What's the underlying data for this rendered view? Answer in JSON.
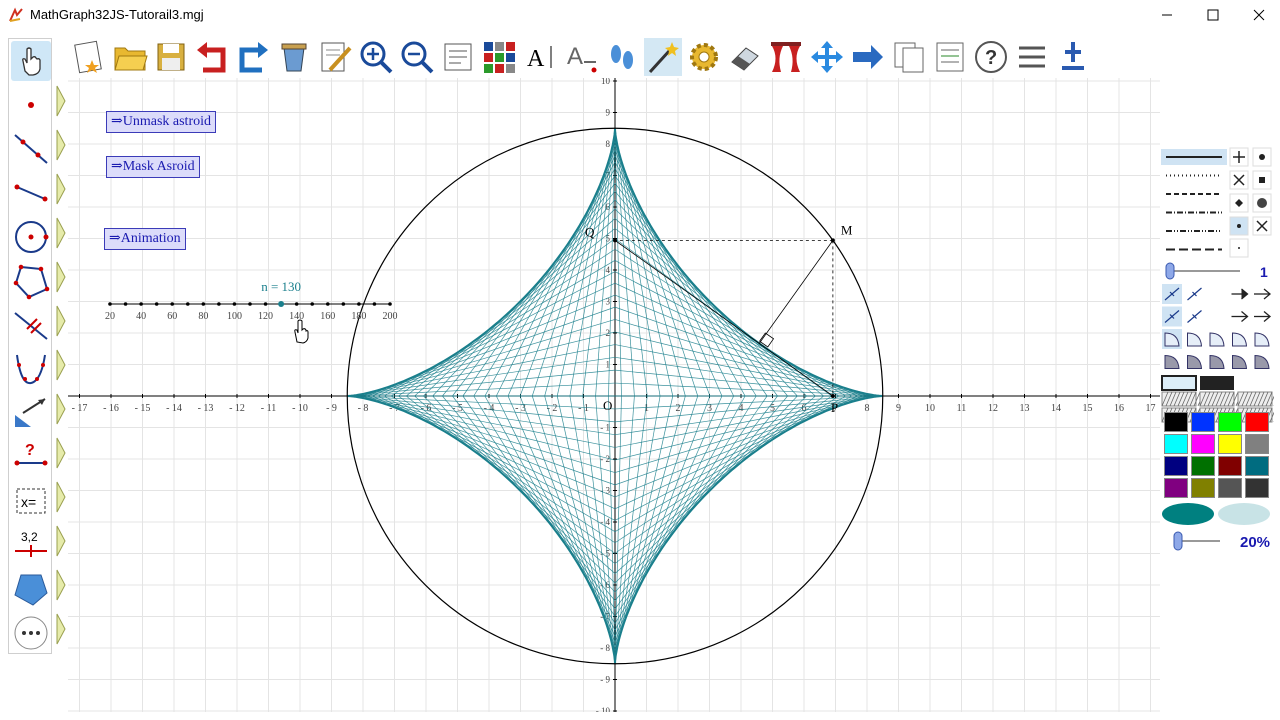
{
  "window": {
    "title": "MathGraph32JS-Tutorail3.mgj",
    "icons": [
      "app-icon",
      "minimize-icon",
      "maximize-icon",
      "close-icon"
    ]
  },
  "left_toolbar": {
    "tools": [
      {
        "name": "pointer-tool",
        "icon": "hand-pointer-icon"
      },
      {
        "name": "point-tool",
        "icon": "point-icon"
      },
      {
        "name": "line-tool",
        "icon": "line-icon"
      },
      {
        "name": "segment-tool",
        "icon": "segment-icon"
      },
      {
        "name": "circle-tool",
        "icon": "circle-icon"
      },
      {
        "name": "polygon-tool",
        "icon": "polygon-icon"
      },
      {
        "name": "parallel-perpendicular-tool",
        "icon": "parallel-icon"
      },
      {
        "name": "curve-tool",
        "icon": "curve-icon"
      },
      {
        "name": "transformation-tool",
        "icon": "transformation-icon"
      },
      {
        "name": "measure-tool",
        "icon": "measure-icon"
      },
      {
        "name": "calculation-tool",
        "icon": "calculation-icon"
      },
      {
        "name": "display-value-tool",
        "icon": "display-value-icon"
      },
      {
        "name": "surface-tool",
        "icon": "surface-icon"
      },
      {
        "name": "more-tools",
        "icon": "more-icon"
      }
    ],
    "calc_label": "x=",
    "value_label": "3,2"
  },
  "top_toolbar": {
    "tools": [
      "new-figure-icon",
      "open-icon",
      "save-icon",
      "undo-icon",
      "redo-icon",
      "recycle-bin-icon",
      "edit-icon",
      "zoom-in-icon",
      "zoom-out-icon",
      "protocol-icon",
      "palette-icon",
      "text-icon",
      "text-format-icon",
      "footprint-icon",
      "wand-icon",
      "settings-icon",
      "eraser-icon",
      "curtain-icon",
      "move-icon",
      "arrow-right-icon",
      "copy-icon",
      "list-icon",
      "help-icon",
      "menu-icon",
      "pin-icon"
    ],
    "text_tool_label": "A"
  },
  "canvas": {
    "macros": [
      {
        "label": "⇒Unmask astroid"
      },
      {
        "label": "⇒Mask Asroid"
      },
      {
        "label": "⇒Animation"
      }
    ],
    "slider": {
      "label": "n = 130",
      "value": 130,
      "min": 20,
      "max": 200,
      "ticks": [
        "20",
        "40",
        "60",
        "80",
        "100",
        "120",
        "140",
        "160",
        "180",
        "200"
      ]
    },
    "x_axis": {
      "ticks": [
        "- 17",
        "- 16",
        "- 15",
        "- 14",
        "- 13",
        "- 12",
        "- 11",
        "- 10",
        "- 9",
        "- 8",
        "- 7",
        "- 6",
        "- 5",
        "- 4",
        "- 3",
        "- 2",
        "- 1",
        "0",
        "1",
        "2",
        "3",
        "4",
        "5",
        "6",
        "7",
        "8",
        "9",
        "10",
        "11",
        "12",
        "13",
        "14",
        "15",
        "16",
        "17"
      ]
    },
    "y_axis": {
      "ticks": [
        "- 10",
        "- 9",
        "- 8",
        "- 7",
        "- 6",
        "- 5",
        "- 4",
        "- 3",
        "- 2",
        "- 1",
        "1",
        "2",
        "3",
        "4",
        "5",
        "6",
        "7",
        "8",
        "9",
        "10"
      ]
    },
    "point_labels": {
      "origin": "O",
      "m": "M",
      "p": "P",
      "q": "Q"
    },
    "colors": {
      "astroid": "#1a7f8c",
      "envelope": "#1a7f8c",
      "grid": "#e4e4e4",
      "circle": "#000000"
    }
  },
  "right_panel": {
    "line_styles": [
      "solid",
      "dotted",
      "dashed",
      "dash-dot",
      "dash-dot-dot",
      "long-dash"
    ],
    "point_styles": [
      "plus",
      "dot",
      "cross",
      "square",
      "diamond",
      "big-dot",
      "small-dot",
      "x-mark",
      "tiny-dot"
    ],
    "thickness_value": "1",
    "opacity_value": "20%",
    "colors": [
      "#000000",
      "#0033ff",
      "#00ff00",
      "#ff0000",
      "#00ffff",
      "#ff00ff",
      "#ffff00",
      "#808080",
      "#000080",
      "#007000",
      "#800000",
      "#006c80",
      "#800080",
      "#808000",
      "#555555",
      "#333333"
    ],
    "selected_color": "#008080",
    "light_color": "#c8e3e6"
  }
}
